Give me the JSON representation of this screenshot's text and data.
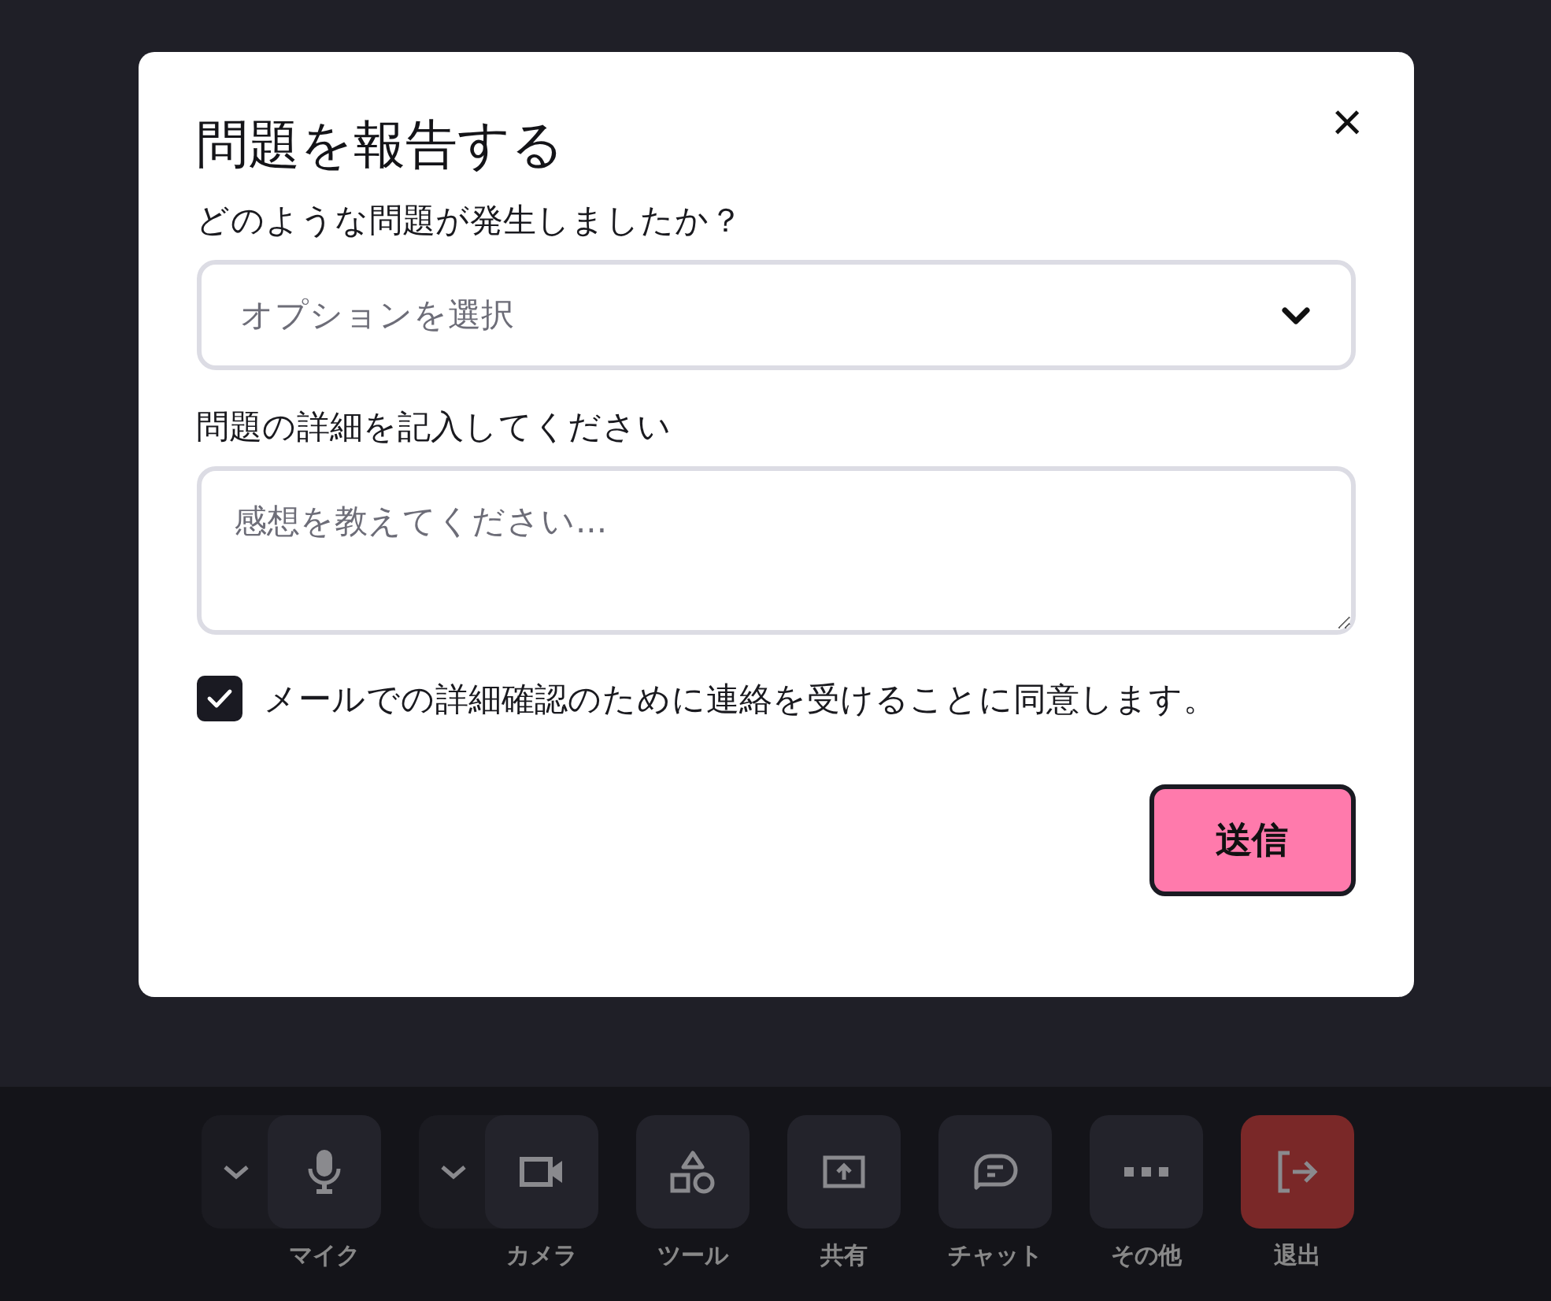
{
  "dialog": {
    "title": "問題を報告する",
    "close": "×",
    "fields": [
      {
        "kind": "select",
        "label": "どのような問題が発生しましたか？",
        "placeholder": "オプションを選択"
      },
      {
        "kind": "textarea",
        "label": "問題の詳細を記入してください",
        "placeholder": "感想を教えてください..."
      }
    ],
    "consent": {
      "label": "メールでの詳細確認のために連絡を受けることに同意します。",
      "checked": true
    },
    "submit": "送信"
  },
  "toolbar": [
    {
      "kind": "mic",
      "label": "マイク",
      "has_menu": true,
      "danger": false
    },
    {
      "kind": "camera",
      "label": "カメラ",
      "has_menu": true,
      "danger": false
    },
    {
      "kind": "tools",
      "label": "ツール",
      "has_menu": false,
      "danger": false
    },
    {
      "kind": "share",
      "label": "共有",
      "has_menu": false,
      "danger": false
    },
    {
      "kind": "chat",
      "label": "チャット",
      "has_menu": false,
      "danger": false
    },
    {
      "kind": "more",
      "label": "その他",
      "has_menu": false,
      "danger": false
    },
    {
      "kind": "leave",
      "label": "退出",
      "has_menu": false,
      "danger": true
    }
  ]
}
